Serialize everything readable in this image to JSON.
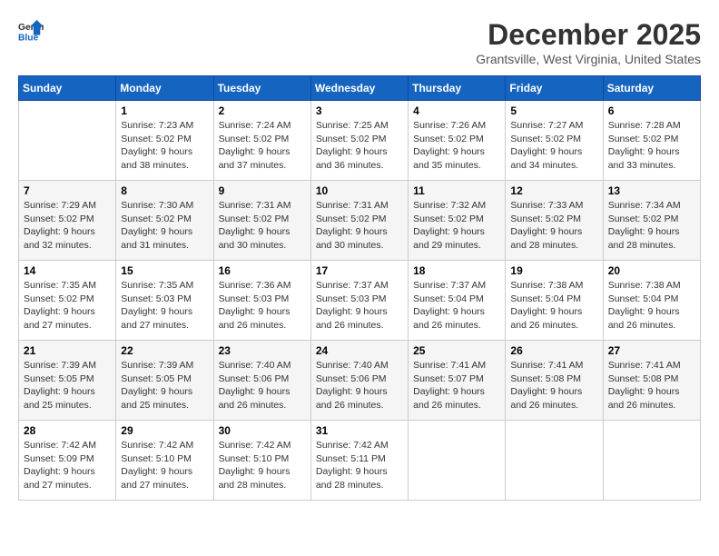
{
  "header": {
    "logo": {
      "general": "General",
      "blue": "Blue"
    },
    "month_year": "December 2025",
    "location": "Grantsville, West Virginia, United States"
  },
  "weekdays": [
    "Sunday",
    "Monday",
    "Tuesday",
    "Wednesday",
    "Thursday",
    "Friday",
    "Saturday"
  ],
  "weeks": [
    [
      {
        "day": "",
        "info": ""
      },
      {
        "day": "1",
        "info": "Sunrise: 7:23 AM\nSunset: 5:02 PM\nDaylight: 9 hours\nand 38 minutes."
      },
      {
        "day": "2",
        "info": "Sunrise: 7:24 AM\nSunset: 5:02 PM\nDaylight: 9 hours\nand 37 minutes."
      },
      {
        "day": "3",
        "info": "Sunrise: 7:25 AM\nSunset: 5:02 PM\nDaylight: 9 hours\nand 36 minutes."
      },
      {
        "day": "4",
        "info": "Sunrise: 7:26 AM\nSunset: 5:02 PM\nDaylight: 9 hours\nand 35 minutes."
      },
      {
        "day": "5",
        "info": "Sunrise: 7:27 AM\nSunset: 5:02 PM\nDaylight: 9 hours\nand 34 minutes."
      },
      {
        "day": "6",
        "info": "Sunrise: 7:28 AM\nSunset: 5:02 PM\nDaylight: 9 hours\nand 33 minutes."
      }
    ],
    [
      {
        "day": "7",
        "info": "Sunrise: 7:29 AM\nSunset: 5:02 PM\nDaylight: 9 hours\nand 32 minutes."
      },
      {
        "day": "8",
        "info": "Sunrise: 7:30 AM\nSunset: 5:02 PM\nDaylight: 9 hours\nand 31 minutes."
      },
      {
        "day": "9",
        "info": "Sunrise: 7:31 AM\nSunset: 5:02 PM\nDaylight: 9 hours\nand 30 minutes."
      },
      {
        "day": "10",
        "info": "Sunrise: 7:31 AM\nSunset: 5:02 PM\nDaylight: 9 hours\nand 30 minutes."
      },
      {
        "day": "11",
        "info": "Sunrise: 7:32 AM\nSunset: 5:02 PM\nDaylight: 9 hours\nand 29 minutes."
      },
      {
        "day": "12",
        "info": "Sunrise: 7:33 AM\nSunset: 5:02 PM\nDaylight: 9 hours\nand 28 minutes."
      },
      {
        "day": "13",
        "info": "Sunrise: 7:34 AM\nSunset: 5:02 PM\nDaylight: 9 hours\nand 28 minutes."
      }
    ],
    [
      {
        "day": "14",
        "info": "Sunrise: 7:35 AM\nSunset: 5:02 PM\nDaylight: 9 hours\nand 27 minutes."
      },
      {
        "day": "15",
        "info": "Sunrise: 7:35 AM\nSunset: 5:03 PM\nDaylight: 9 hours\nand 27 minutes."
      },
      {
        "day": "16",
        "info": "Sunrise: 7:36 AM\nSunset: 5:03 PM\nDaylight: 9 hours\nand 26 minutes."
      },
      {
        "day": "17",
        "info": "Sunrise: 7:37 AM\nSunset: 5:03 PM\nDaylight: 9 hours\nand 26 minutes."
      },
      {
        "day": "18",
        "info": "Sunrise: 7:37 AM\nSunset: 5:04 PM\nDaylight: 9 hours\nand 26 minutes."
      },
      {
        "day": "19",
        "info": "Sunrise: 7:38 AM\nSunset: 5:04 PM\nDaylight: 9 hours\nand 26 minutes."
      },
      {
        "day": "20",
        "info": "Sunrise: 7:38 AM\nSunset: 5:04 PM\nDaylight: 9 hours\nand 26 minutes."
      }
    ],
    [
      {
        "day": "21",
        "info": "Sunrise: 7:39 AM\nSunset: 5:05 PM\nDaylight: 9 hours\nand 25 minutes."
      },
      {
        "day": "22",
        "info": "Sunrise: 7:39 AM\nSunset: 5:05 PM\nDaylight: 9 hours\nand 25 minutes."
      },
      {
        "day": "23",
        "info": "Sunrise: 7:40 AM\nSunset: 5:06 PM\nDaylight: 9 hours\nand 26 minutes."
      },
      {
        "day": "24",
        "info": "Sunrise: 7:40 AM\nSunset: 5:06 PM\nDaylight: 9 hours\nand 26 minutes."
      },
      {
        "day": "25",
        "info": "Sunrise: 7:41 AM\nSunset: 5:07 PM\nDaylight: 9 hours\nand 26 minutes."
      },
      {
        "day": "26",
        "info": "Sunrise: 7:41 AM\nSunset: 5:08 PM\nDaylight: 9 hours\nand 26 minutes."
      },
      {
        "day": "27",
        "info": "Sunrise: 7:41 AM\nSunset: 5:08 PM\nDaylight: 9 hours\nand 26 minutes."
      }
    ],
    [
      {
        "day": "28",
        "info": "Sunrise: 7:42 AM\nSunset: 5:09 PM\nDaylight: 9 hours\nand 27 minutes."
      },
      {
        "day": "29",
        "info": "Sunrise: 7:42 AM\nSunset: 5:10 PM\nDaylight: 9 hours\nand 27 minutes."
      },
      {
        "day": "30",
        "info": "Sunrise: 7:42 AM\nSunset: 5:10 PM\nDaylight: 9 hours\nand 28 minutes."
      },
      {
        "day": "31",
        "info": "Sunrise: 7:42 AM\nSunset: 5:11 PM\nDaylight: 9 hours\nand 28 minutes."
      },
      {
        "day": "",
        "info": ""
      },
      {
        "day": "",
        "info": ""
      },
      {
        "day": "",
        "info": ""
      }
    ]
  ]
}
